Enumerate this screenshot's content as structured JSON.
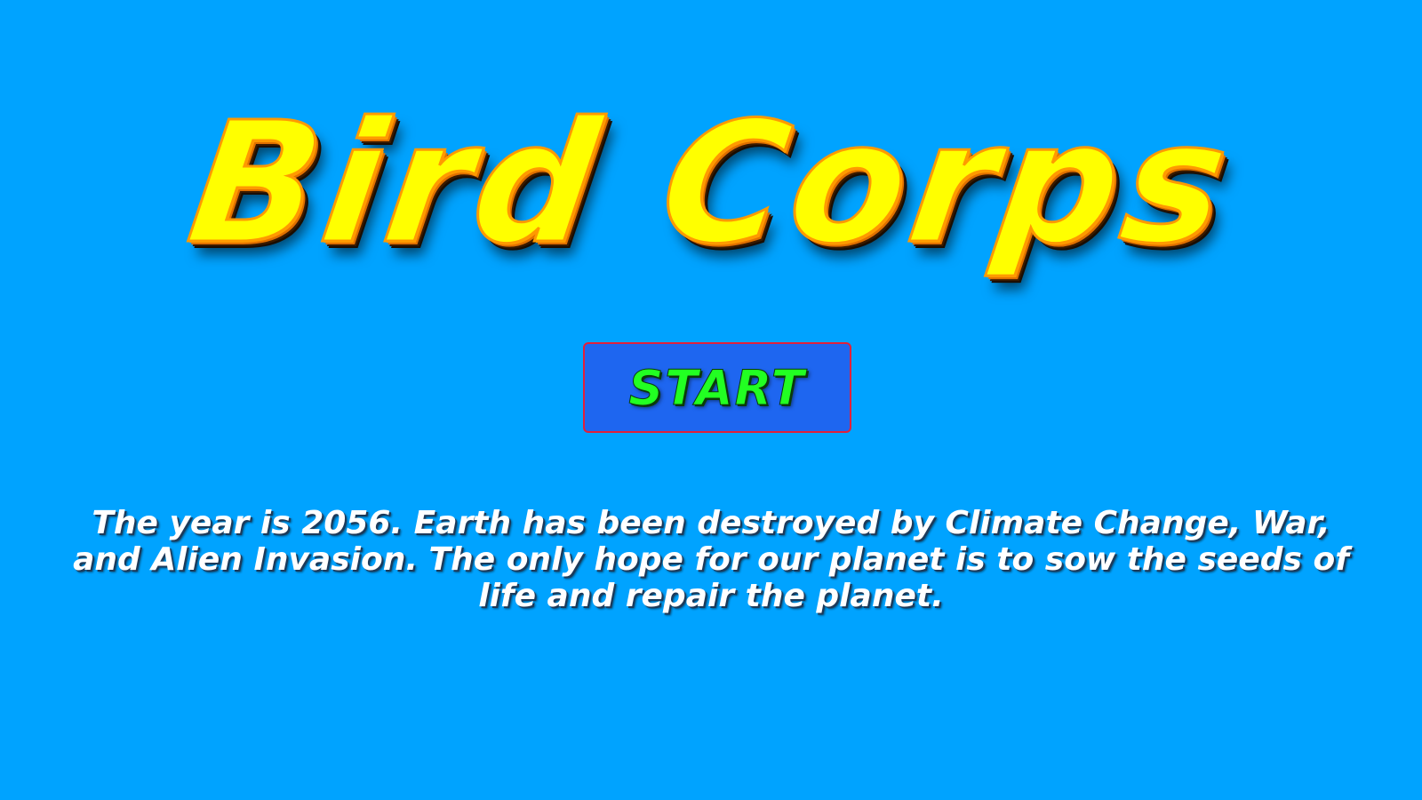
{
  "game": {
    "title": "Bird Corps",
    "start_label": "START",
    "intro_text": "The year is 2056. Earth has been destroyed by Climate Change, War, and Alien Invasion. The only hope for our planet is to sow the seeds of life and repair the planet."
  },
  "colors": {
    "background": "#00a3ff",
    "title_fill": "#ffff00",
    "title_outline": "#ff9a00",
    "button_fill": "#1e66f0",
    "button_border": "#e2203a",
    "button_text": "#22ff22",
    "intro_text": "#ffffff"
  }
}
